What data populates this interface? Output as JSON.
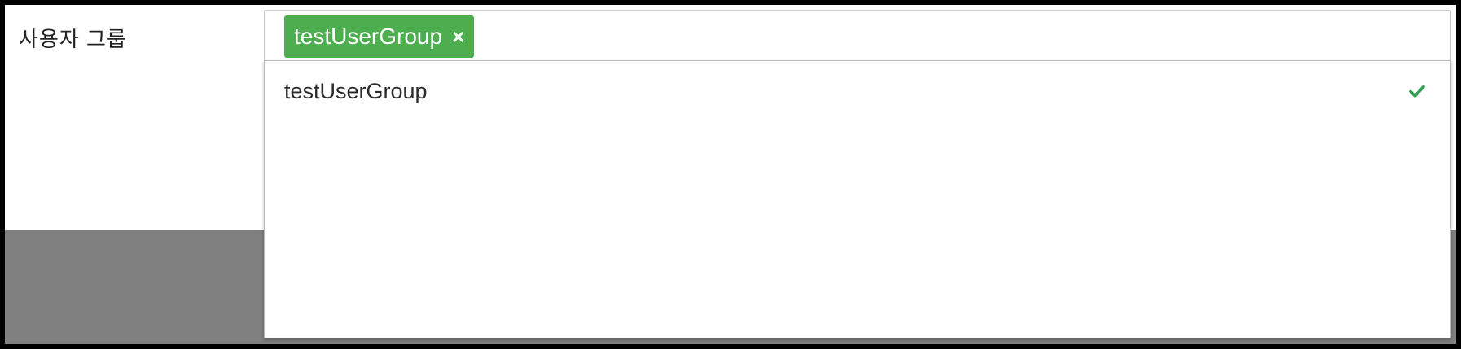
{
  "field": {
    "label": "사용자 그룹"
  },
  "select": {
    "selected_tags": [
      {
        "label": "testUserGroup",
        "remove_symbol": "×"
      }
    ]
  },
  "dropdown": {
    "options": [
      {
        "label": "testUserGroup",
        "selected": true,
        "check_icon": "checkmark-icon"
      }
    ]
  },
  "colors": {
    "tag_background": "#4cae4f",
    "check_color": "#2e9e4f",
    "overlay": "#808080"
  }
}
